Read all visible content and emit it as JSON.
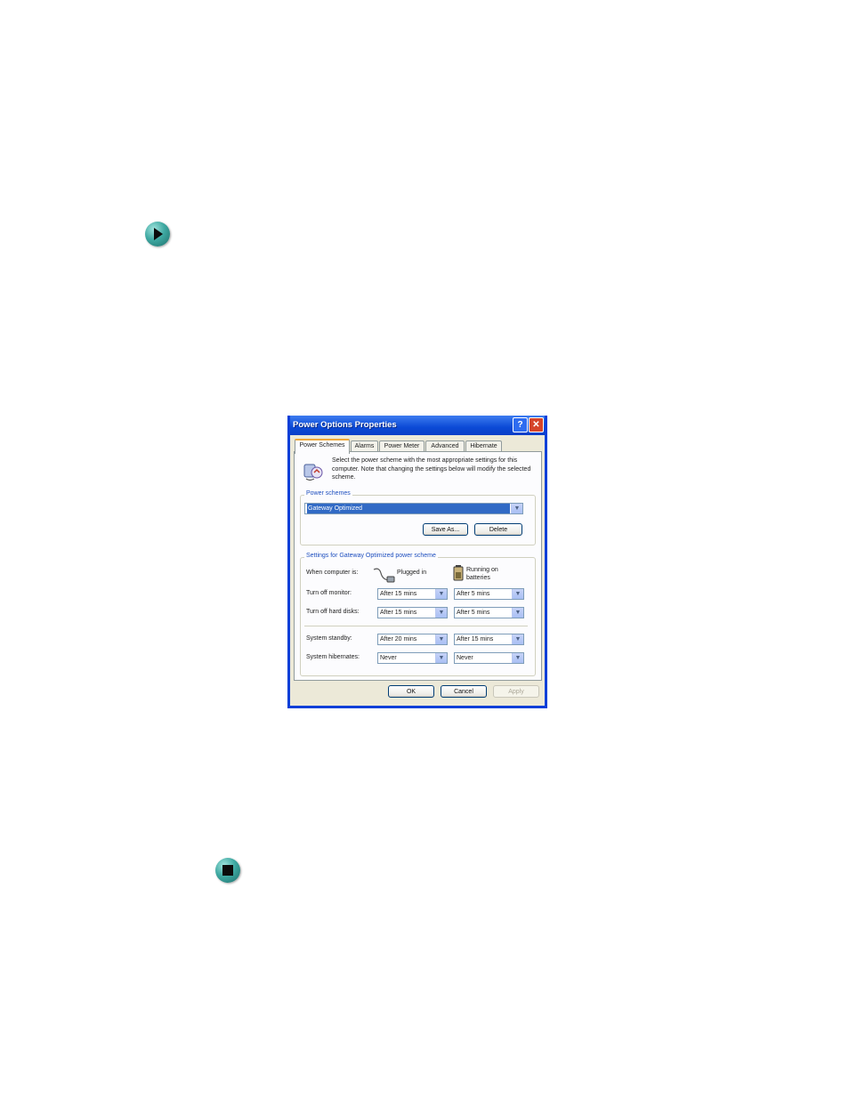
{
  "dialog": {
    "title": "Power Options Properties",
    "help_button": "?",
    "close_button": "✕",
    "tabs": [
      {
        "label": "Power Schemes",
        "active": true
      },
      {
        "label": "Alarms"
      },
      {
        "label": "Power Meter"
      },
      {
        "label": "Advanced"
      },
      {
        "label": "Hibernate"
      }
    ],
    "intro_text": "Select the power scheme with the most appropriate settings for this computer. Note that changing the settings below will modify the selected scheme.",
    "power_schemes": {
      "legend": "Power schemes",
      "selected": "Gateway Optimized",
      "save_as": "Save As...",
      "delete": "Delete"
    },
    "settings": {
      "legend": "Settings for Gateway Optimized power scheme",
      "when_label": "When computer is:",
      "plugged_in": "Plugged in",
      "on_batteries": "Running on batteries",
      "rows": [
        {
          "label": "Turn off monitor:",
          "plugged": "After 15 mins",
          "battery": "After 5 mins"
        },
        {
          "label": "Turn off hard disks:",
          "plugged": "After 15 mins",
          "battery": "After 5 mins"
        },
        {
          "label": "System standby:",
          "plugged": "After 20 mins",
          "battery": "After 15 mins"
        },
        {
          "label": "System hibernates:",
          "plugged": "Never",
          "battery": "Never"
        }
      ]
    },
    "buttons": {
      "ok": "OK",
      "cancel": "Cancel",
      "apply": "Apply"
    }
  }
}
